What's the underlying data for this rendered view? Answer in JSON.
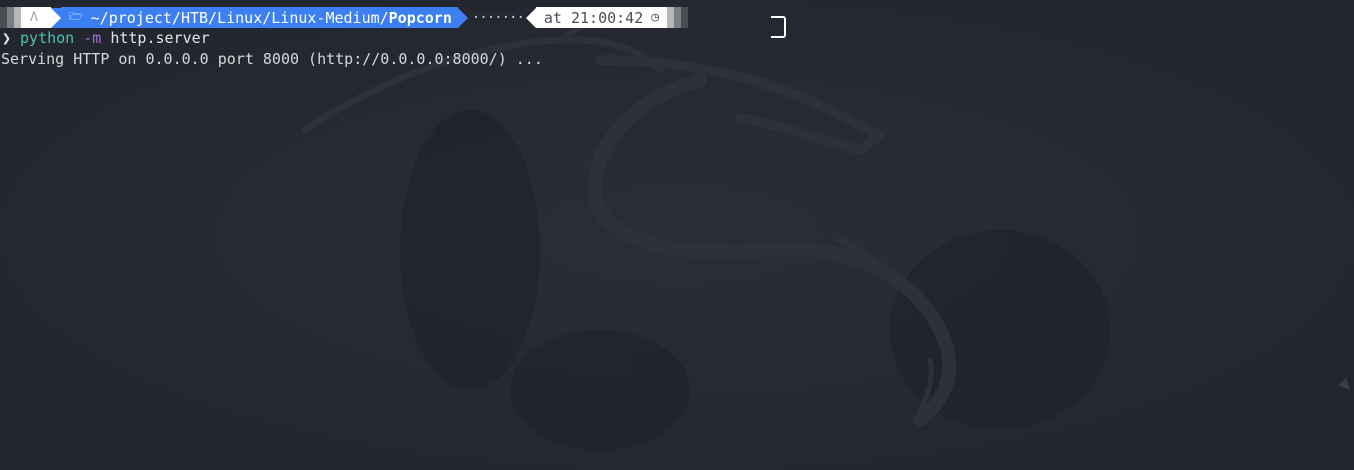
{
  "prompt": {
    "os_icon": "linux-tux-icon",
    "folder_icon": "folder-icon",
    "path_prefix": "~/project/HTB/Linux/Linux-Medium/",
    "path_current": "Popcorn",
    "filler": "·······",
    "time_label": "at 21:00:42",
    "clock_icon": "clock-icon",
    "colors": {
      "dir_bg": "#3b7ff0",
      "segment_bg": "#ffffff",
      "background": "#23262e"
    }
  },
  "command": {
    "chevron": "❯",
    "program": "python",
    "flag": "-m",
    "argument": "http.server"
  },
  "output": {
    "line1": "Serving HTTP on 0.0.0.0 port 8000 (http://0.0.0.0:8000/) ..."
  }
}
